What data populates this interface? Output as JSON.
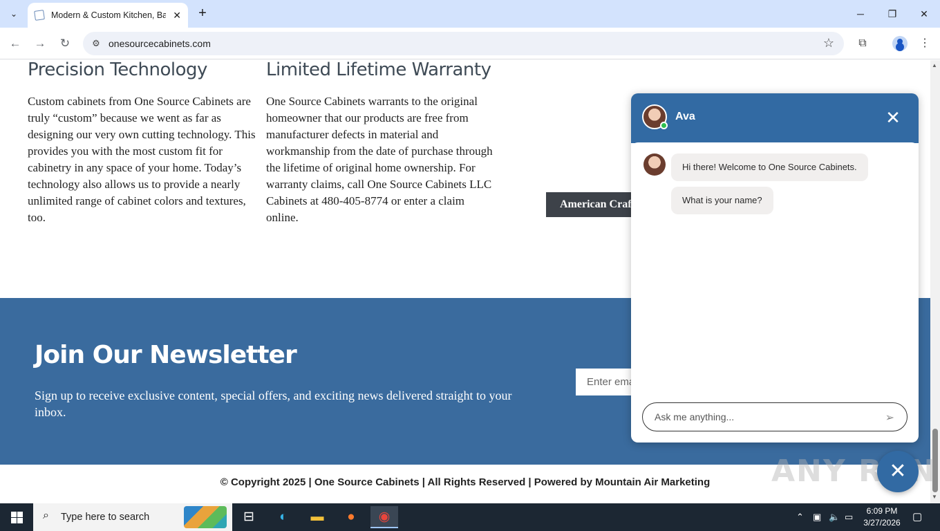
{
  "browser": {
    "tab_title": "Modern & Custom Kitchen, Bath",
    "tab_close": "✕",
    "new_tab": "+",
    "url": "onesourcecabinets.com",
    "window": {
      "minimize": "─",
      "maximize": "❐",
      "close": "✕"
    }
  },
  "page": {
    "col1": {
      "heading": "Precision Technology",
      "text": "Custom cabinets from One Source Cabinets are truly “custom” because we went as far as designing our very own cutting technology. This provides you with the most custom fit for cabinetry in any space of your home. Today’s technology also allows us to provide a nearly unlimited range of cabinet colors and textures, too."
    },
    "col2": {
      "heading": "Limited Lifetime Warranty",
      "text": "One Source Cabinets warrants to the original homeowner that our products are free from manufacturer defects in material and workmanship from the date of purchase through the lifetime of original home ownership. For warranty claims, call One Source Cabinets LLC Cabinets at 480-405-8774 or enter a claim online."
    },
    "american_button": "American Craftsmanship",
    "newsletter": {
      "title": "Join Our Newsletter",
      "text": "Sign up to receive exclusive content, special offers, and exciting news delivered straight to your inbox.",
      "email_placeholder": "Enter email"
    },
    "footer": "© Copyright 2025 | One Source Cabinets | All Rights Reserved | Powered by Mountain Air Marketing"
  },
  "chat": {
    "agent_name": "Ava",
    "close": "✕",
    "messages": [
      "Hi there! Welcome to One Source Cabinets.",
      "What is your name?"
    ],
    "input_placeholder": "Ask me anything...",
    "accent": "#326aa3"
  },
  "watermark": "ANY RUN",
  "taskbar": {
    "search_placeholder": "Type here to search",
    "time": "6:09 PM",
    "date": "3/27/2026"
  }
}
